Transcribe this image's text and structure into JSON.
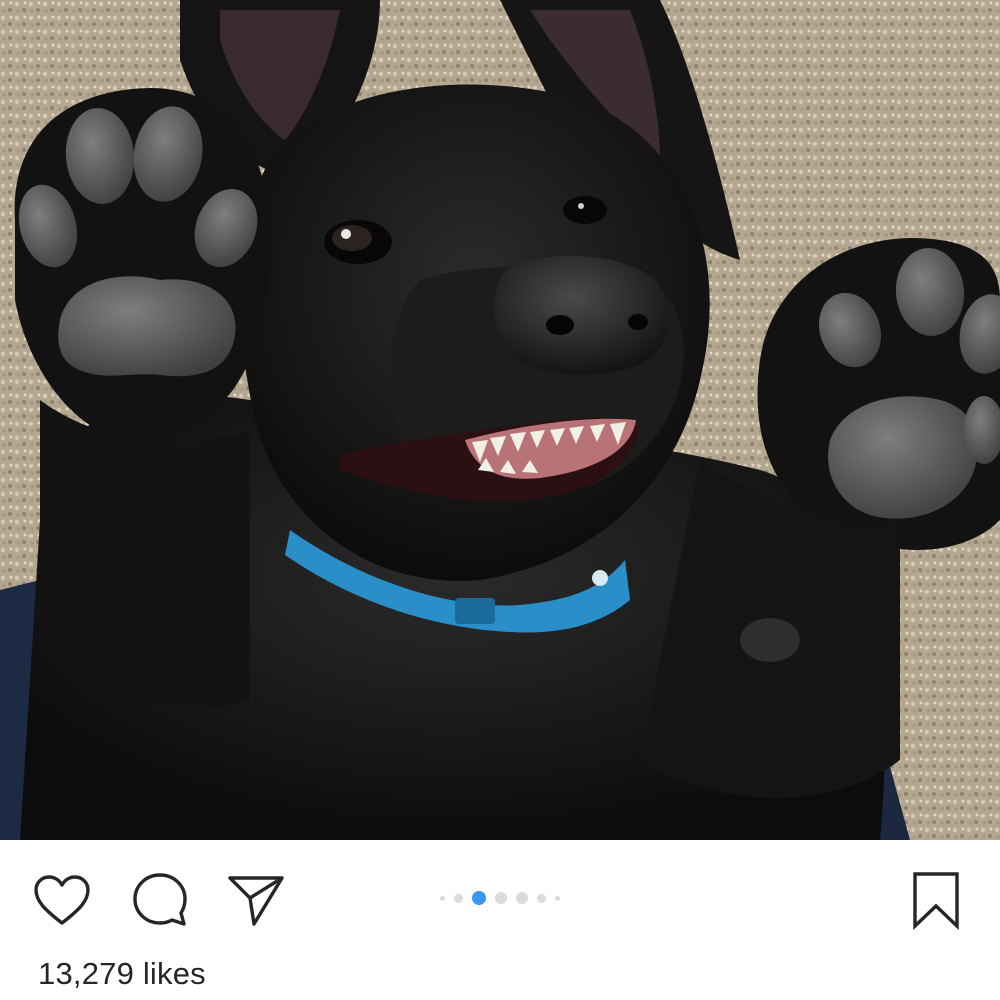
{
  "post": {
    "photo_alt": "",
    "likes_text": "13,279 likes",
    "carousel": {
      "total": 7,
      "active_index": 2
    }
  },
  "colors": {
    "active_dot": "#3897f0",
    "inactive_dot": "#dbdbdb",
    "icon": "#262626",
    "carpet": "#b7a892",
    "fur": "#121212",
    "collar": "#2a8fc9"
  },
  "icons": {
    "like": "heart-icon",
    "comment": "comment-bubble-icon",
    "share": "paper-plane-icon",
    "save": "bookmark-icon"
  }
}
